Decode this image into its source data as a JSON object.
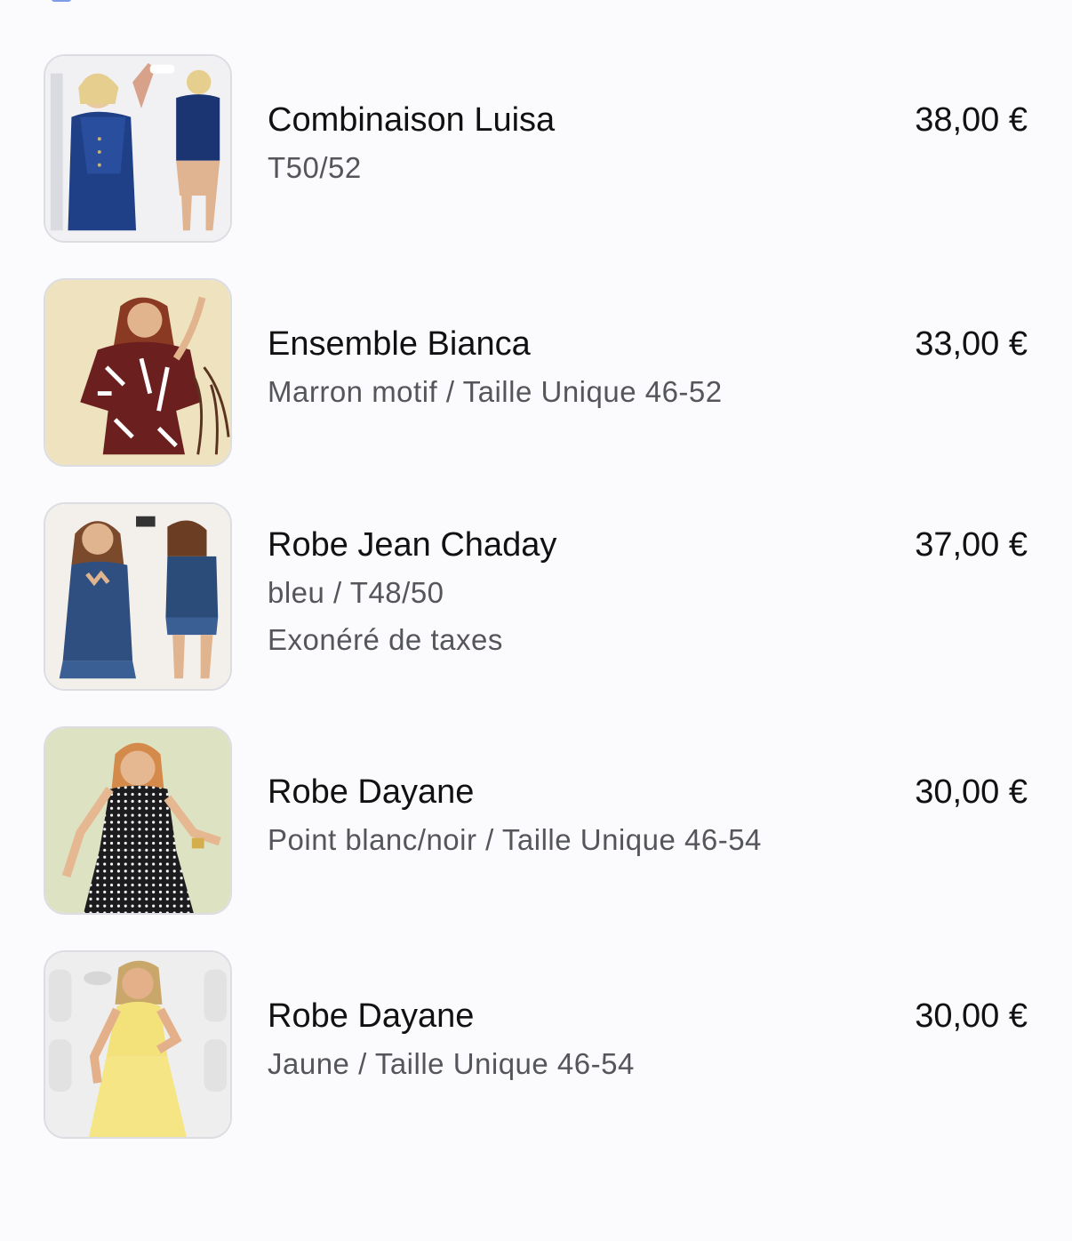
{
  "items": [
    {
      "name": "Combinaison Luisa",
      "variant": "T50/52",
      "note": "",
      "price": "38,00 €",
      "image_desc": "denim-overall-dress"
    },
    {
      "name": "Ensemble Bianca",
      "variant": "Marron motif / Taille Unique 46-52",
      "note": "",
      "price": "33,00 €",
      "image_desc": "brown-patterned-set"
    },
    {
      "name": "Robe Jean Chaday",
      "variant": "bleu / T48/50",
      "note": "Exonéré de taxes",
      "price": "37,00 €",
      "image_desc": "blue-denim-dress"
    },
    {
      "name": "Robe Dayane",
      "variant": "Point blanc/noir / Taille Unique 46-54",
      "note": "",
      "price": "30,00 €",
      "image_desc": "polka-dot-dress"
    },
    {
      "name": "Robe Dayane",
      "variant": "Jaune / Taille Unique 46-54",
      "note": "",
      "price": "30,00 €",
      "image_desc": "yellow-dress"
    }
  ],
  "colors": {
    "background": "#fbfbfd",
    "text_primary": "#111111",
    "text_secondary": "#55565c",
    "thumb_border": "#dcdde2"
  }
}
